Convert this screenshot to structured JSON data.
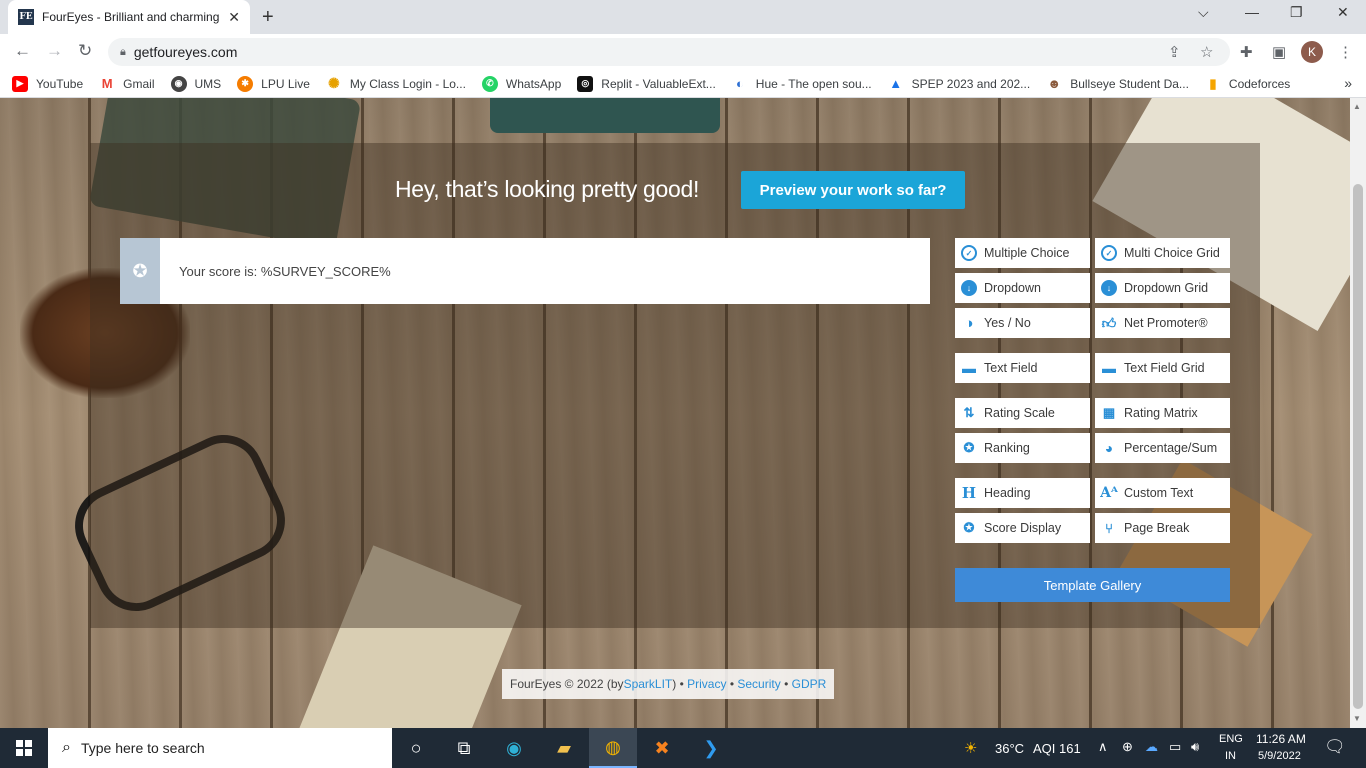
{
  "browser": {
    "tab_title": "FourEyes - Brilliant and charming",
    "tab_favicon": "FE",
    "url": "getfoureyes.com",
    "profile_initial": "K"
  },
  "bookmarks": [
    {
      "label": "YouTube",
      "color": "#ff0000",
      "glyph": "▶"
    },
    {
      "label": "Gmail",
      "color": "#ea4335",
      "glyph": "M"
    },
    {
      "label": "UMS",
      "color": "#444444",
      "glyph": "◉"
    },
    {
      "label": "LPU Live",
      "color": "#f57c00",
      "glyph": "✱"
    },
    {
      "label": "My Class Login - Lo...",
      "color": "#e6a100",
      "glyph": "✺"
    },
    {
      "label": "WhatsApp",
      "color": "#25d366",
      "glyph": "✆"
    },
    {
      "label": "Replit - ValuableExt...",
      "color": "#111111",
      "glyph": "◎"
    },
    {
      "label": "Hue - The open sou...",
      "color": "#2d6fd3",
      "glyph": "◐"
    },
    {
      "label": "SPEP 2023 and 202...",
      "color": "#1a73e8",
      "glyph": "▲"
    },
    {
      "label": "Bullseye Student Da...",
      "color": "#8a5a3c",
      "glyph": "☻"
    },
    {
      "label": "Codeforces",
      "color": "#f5c518",
      "glyph": "▮"
    }
  ],
  "main": {
    "heading": "Hey, that’s looking pretty good!",
    "preview_button": "Preview your work so far?",
    "score_text": "Your score is: %SURVEY_SCORE%"
  },
  "question_types": [
    {
      "label": "Multiple Choice",
      "icon": "check-circle-icon"
    },
    {
      "label": "Multi Choice Grid",
      "icon": "check-circle-icon"
    },
    {
      "label": "Dropdown",
      "icon": "arrow-down-circle-icon"
    },
    {
      "label": "Dropdown Grid",
      "icon": "arrow-down-circle-icon"
    },
    {
      "label": "Yes / No",
      "icon": "half-circle-icon"
    },
    {
      "label": "Net Promoter®",
      "icon": "thumbs-up-icon"
    },
    {
      "label": "Text Field",
      "icon": "speech-bubble-icon"
    },
    {
      "label": "Text Field Grid",
      "icon": "speech-bubble-icon"
    },
    {
      "label": "Rating Scale",
      "icon": "sort-icon"
    },
    {
      "label": "Rating Matrix",
      "icon": "grid-icon"
    },
    {
      "label": "Ranking",
      "icon": "award-icon"
    },
    {
      "label": "Percentage/Sum",
      "icon": "pie-icon"
    },
    {
      "label": "Heading",
      "icon": "heading-icon"
    },
    {
      "label": "Custom Text",
      "icon": "text-size-icon"
    },
    {
      "label": "Score Display",
      "icon": "award-icon"
    },
    {
      "label": "Page Break",
      "icon": "branch-icon"
    }
  ],
  "template_gallery": "Template Gallery",
  "footer": {
    "prefix": "FourEyes © 2022 (by ",
    "sparklit": "SparkLIT",
    "close_paren": ") •",
    "privacy": "Privacy",
    "sep1": "•",
    "security": "Security",
    "sep2": "•",
    "gdpr": "GDPR"
  },
  "taskbar": {
    "search_placeholder": "Type here to search",
    "weather": "36°C",
    "aqi": "AQI 161",
    "lang_top": "ENG",
    "lang_bottom": "IN",
    "time": "11:26 AM",
    "date": "5/9/2022"
  },
  "colors": {
    "accent": "#1ba5d8",
    "gallery": "#3e8ad8",
    "icon_blue": "#2a8fd6"
  }
}
